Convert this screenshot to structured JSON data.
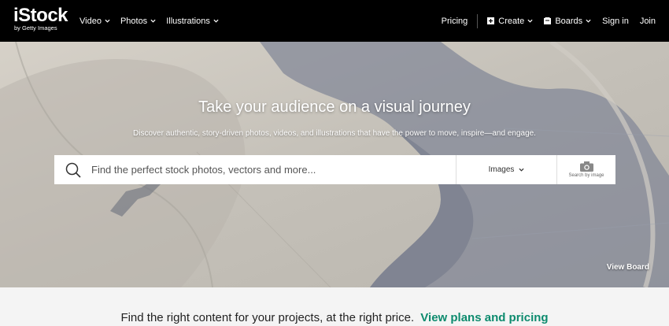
{
  "header": {
    "logo": "iStock",
    "logo_sub": "by Getty Images",
    "nav_left": [
      "Video",
      "Photos",
      "Illustrations"
    ],
    "pricing": "Pricing",
    "create": "Create",
    "boards": "Boards",
    "sign_in": "Sign in",
    "join": "Join"
  },
  "hero": {
    "title": "Take your audience on a visual journey",
    "subtitle": "Discover authentic, story-driven photos, videos, and illustrations that have the power to move, inspire—and engage.",
    "view_board": "View Board"
  },
  "search": {
    "placeholder": "Find the perfect stock photos, vectors and more...",
    "type_selected": "Images",
    "image_search_label": "Search by image"
  },
  "promo": {
    "text": "Find the right content for your projects, at the right price.",
    "link": "View plans and pricing",
    "link_color": "#0d8b6e"
  }
}
